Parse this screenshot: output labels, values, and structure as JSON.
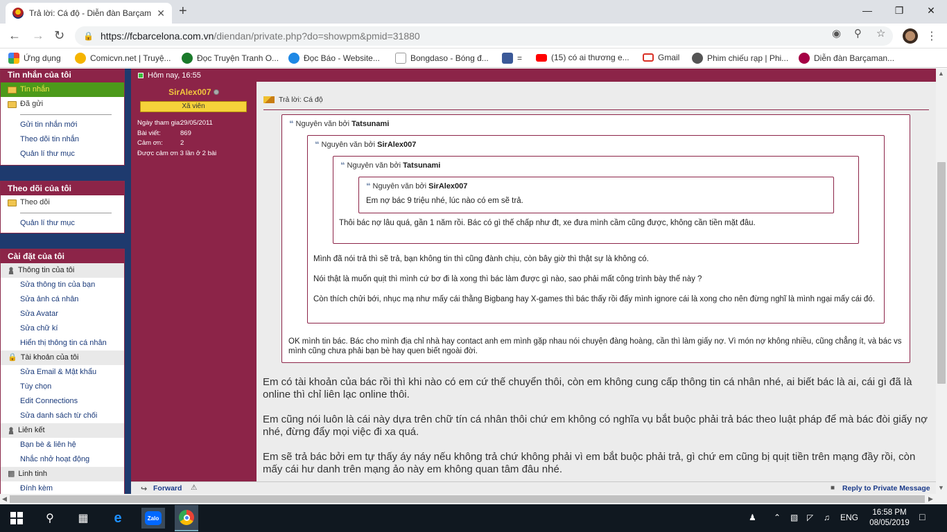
{
  "browser": {
    "tab_title": "Trả lời: Cá độ - Diễn đàn Barçama",
    "new_tab_label": "+",
    "url_host": "https://fcbarcelona.com.vn",
    "url_path": "/diendan/private.php?do=showpm&pmid=31880"
  },
  "bookmarks": [
    {
      "label": "Ứng dụng",
      "icon": "apps-icon",
      "color": "#ea4335"
    },
    {
      "label": "Comicvn.net | Truyệ...",
      "icon": "comicvn-icon",
      "color": "#f5b400"
    },
    {
      "label": "Đọc Truyện Tranh O...",
      "icon": "truyen-icon",
      "color": "#1a7a2a"
    },
    {
      "label": "Đọc Báo - Website...",
      "icon": "docbao-icon",
      "color": "#1e88e5"
    },
    {
      "label": "Bongdaso - Bóng đ...",
      "icon": "page-icon",
      "color": "#9e9e9e"
    },
    {
      "label": "=",
      "icon": "facebook-icon",
      "color": "#3b5998"
    },
    {
      "label": "(15) có ai thương e...",
      "icon": "youtube-icon",
      "color": "#ff0000"
    },
    {
      "label": "Gmail",
      "icon": "gmail-icon",
      "color": "#d93025"
    },
    {
      "label": "Phim chiếu rạp | Phi...",
      "icon": "film-icon",
      "color": "#555555"
    },
    {
      "label": "Diễn đàn Barçaman...",
      "icon": "barca-icon",
      "color": "#a50044"
    }
  ],
  "sidebar": {
    "messages": {
      "header": "Tin nhắn của tôi",
      "inbox": "Tin nhắn",
      "sent": "Đã gửi",
      "links": [
        "Gửi tin nhắn mới",
        "Theo dõi tin nhắn",
        "Quản lí thư mục"
      ]
    },
    "subscriptions": {
      "header": "Theo dõi của tôi",
      "folder": "Theo dõi",
      "links": [
        "Quản lí thư mục"
      ]
    },
    "settings": {
      "header": "Cài đặt của tôi",
      "groups": [
        {
          "label": "Thông tin của tôi",
          "icon": "person-icon",
          "items": [
            "Sửa thông tin của bạn",
            "Sửa ảnh cá nhân",
            "Sửa Avatar",
            "Sửa chữ kí",
            "Hiển thị thông tin cá nhân"
          ]
        },
        {
          "label": "Tài khoản của tôi",
          "icon": "lock-icon",
          "items": [
            "Sửa Email & Mật khẩu",
            "Tùy chọn",
            "Edit Connections",
            "Sửa danh sách từ chối"
          ]
        },
        {
          "label": "Liên kết",
          "icon": "people-icon",
          "items": [
            "Bạn bè & liên hệ",
            "Nhắc nhở hoạt động"
          ]
        },
        {
          "label": "Linh tinh",
          "icon": "misc-icon",
          "items": [
            "Đính kèm"
          ]
        }
      ]
    }
  },
  "post": {
    "date": "Hôm nay, 16:55",
    "user": {
      "name": "SirAlex007",
      "rank": "Xã viên",
      "stats": [
        {
          "label": "Ngày tham gia:",
          "value": "29/05/2011"
        },
        {
          "label": "Bài viết:",
          "value": "869"
        },
        {
          "label": "Cảm ơn:",
          "value": "2"
        },
        {
          "label": "Được cảm ơn 3 lần ở 2 bài",
          "value": ""
        }
      ]
    },
    "title": "Trả lời: Cá độ",
    "quote_prefix": "Nguyên văn bởi",
    "quotes": [
      {
        "author": "Tatsunami",
        "paragraphs": [
          "OK mình tin bác. Bác cho mình địa chỉ nhà hay contact anh em mình gặp nhau nói chuyện đàng hoàng, cần thì làm giấy nợ. Vì món nợ không nhiều, cũng chẳng ít, và bác vs mình cũng chưa phải bạn bè hay quen biết ngoài đời."
        ]
      },
      {
        "author": "SirAlex007",
        "paragraphs": [
          "Mình đã nói trả thì sẽ trả, bạn không tin thì cũng đành chịu, còn bây giờ thì thật sự là không có.",
          "Nói thật là muốn quịt thì mình cứ bơ đi là xong thì bác làm được gì nào, sao phải mất công trình bày thế này ?",
          "Còn thích chửi bới, nhục mạ như mấy cái thằng Bigbang hay X-games thì bác thấy rồi đấy mình ignore cái là xong cho nên đừng nghĩ là mình ngại mấy cái đó."
        ]
      },
      {
        "author": "Tatsunami",
        "paragraphs": [
          "Thôi bác nợ lâu quá, gần 1 năm rồi. Bác có gì thế chấp như đt, xe đưa mình cầm cũng được, không cần tiền mặt đâu."
        ]
      },
      {
        "author": "SirAlex007",
        "paragraphs": [
          "Em nợ bác 9 triệu nhé, lúc nào có em sẽ trả."
        ]
      }
    ],
    "body": [
      "Em có tài khoản của bác rồi thì khi nào có em cứ thế chuyển thôi, còn em không cung cấp thông tin cá nhân nhé, ai biết bác là ai, cái gì đã là online thì chỉ liên lạc online thôi.",
      "Em cũng nói luôn là cái này dựa trên chữ tín cá nhân thôi chứ em không có nghĩa vụ bắt buộc phải trả bác theo luật pháp để mà bác đòi giấy nợ nhé, đừng đẩy mọi việc đi xa quá.",
      "Em sẽ trả bác bởi em tự thấy áy náy nếu không trả chứ không phải vì em bắt buộc phải trả, gì chứ em cũng bị quịt tiền trên mạng đầy rồi, còn mấy cái hư danh trên mạng ảo này em không quan tâm đâu nhé."
    ],
    "forward_label": "Forward",
    "reply_label": "Reply to Private Message"
  },
  "taskbar": {
    "language": "ENG",
    "time": "16:58 PM",
    "date": "08/05/2019",
    "zalo_label": "Zalo"
  },
  "colors": {
    "maroon": "#8c2448",
    "navy": "#1e3a6e",
    "highlight_green": "#4c9a1a",
    "username_gold": "#f2c63d"
  }
}
